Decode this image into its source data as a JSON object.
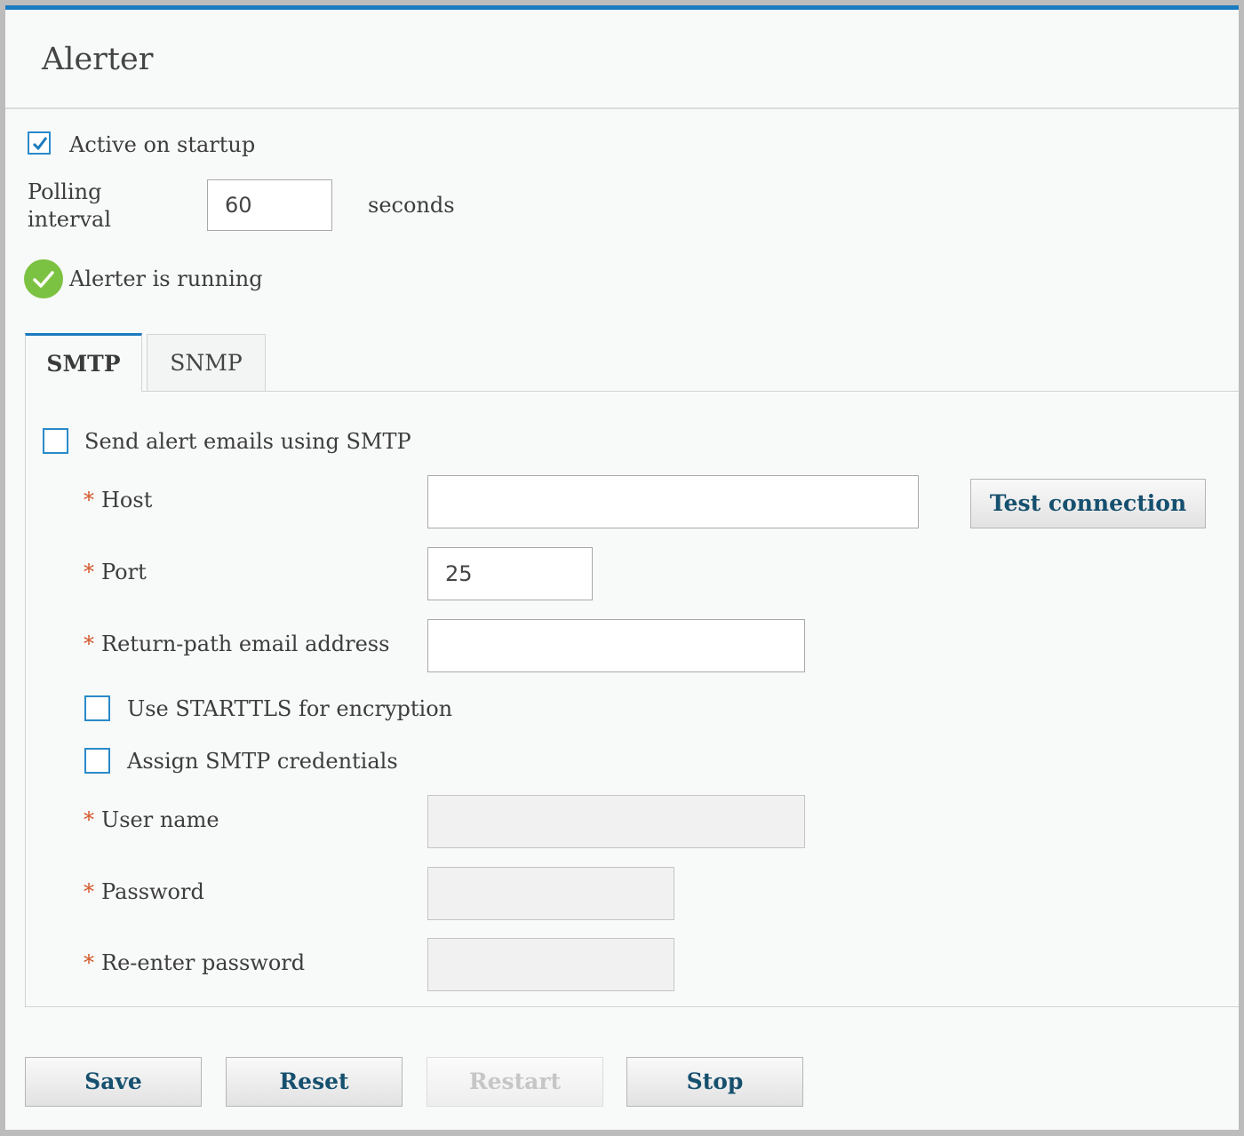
{
  "page": {
    "title": "Alerter"
  },
  "general": {
    "active_on_startup": {
      "label": "Active on startup",
      "checked": true
    },
    "polling_interval": {
      "label_line1": "Polling",
      "label_line2": "interval",
      "value": "60",
      "unit": "seconds"
    },
    "status": {
      "text": "Alerter is running",
      "color": "#7cc242"
    }
  },
  "tabs": [
    {
      "label": "SMTP",
      "active": true
    },
    {
      "label": "SNMP",
      "active": false
    }
  ],
  "smtp": {
    "send_alerts": {
      "label": "Send alert emails using SMTP",
      "checked": false
    },
    "host": {
      "label": "Host",
      "required": "*",
      "value": ""
    },
    "test_connection_label": "Test connection",
    "port": {
      "label": "Port",
      "required": "*",
      "value": "25"
    },
    "return_path": {
      "label": "Return-path email address",
      "required": "*",
      "value": ""
    },
    "starttls": {
      "label": "Use STARTTLS for encryption",
      "checked": false
    },
    "assign_credentials": {
      "label": "Assign SMTP credentials",
      "checked": false
    },
    "user_name": {
      "label": "User name",
      "required": "*",
      "value": ""
    },
    "password": {
      "label": "Password",
      "required": "*",
      "value": ""
    },
    "reenter_password": {
      "label": "Re-enter password",
      "required": "*",
      "value": ""
    }
  },
  "buttons": {
    "save": "Save",
    "reset": "Reset",
    "restart": "Restart",
    "stop": "Stop"
  },
  "colors": {
    "accent": "#1a7bbf",
    "button_text": "#16506f",
    "required": "#d4582a"
  }
}
